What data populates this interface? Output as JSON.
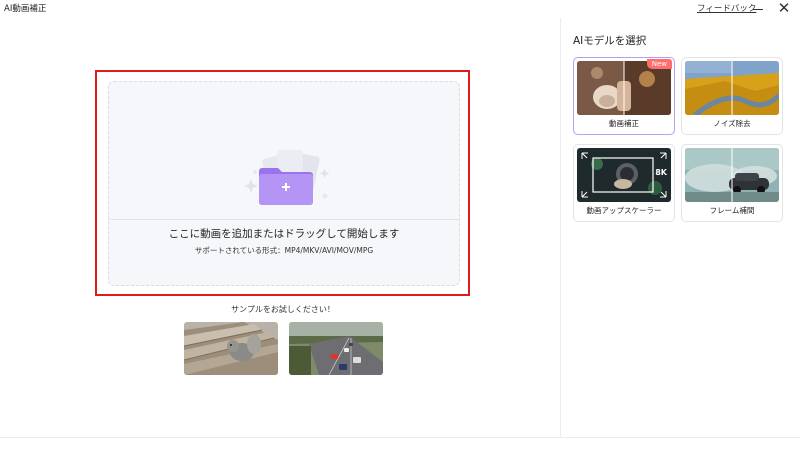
{
  "window": {
    "title": "AI動画補正",
    "feedback_label": "フィードバック",
    "minimize_label": "",
    "close_label": "✕"
  },
  "upload": {
    "main_text": "ここに動画を追加またはドラッグして開始します",
    "formats_text": "サポートされている形式：MP4/MKV/AVI/MOV/MPG"
  },
  "samples": {
    "label": "サンプルをお試しください！",
    "items": [
      {
        "name": "squirrel-on-bench"
      },
      {
        "name": "highway-cars"
      }
    ]
  },
  "models": {
    "title": "AIモデルを選択",
    "items": [
      {
        "label": "動画補正",
        "selected": true,
        "badge": "New"
      },
      {
        "label": "ノイズ除去",
        "selected": false
      },
      {
        "label": "動画アップスケーラー",
        "selected": false,
        "overlay": "8K"
      },
      {
        "label": "フレーム補間",
        "selected": false
      }
    ]
  },
  "colors": {
    "highlight_border": "#e01a1a",
    "selected_card_border": "#b69cf5",
    "folder_purple": "#a987f0",
    "new_badge": "#ff6d6d"
  }
}
